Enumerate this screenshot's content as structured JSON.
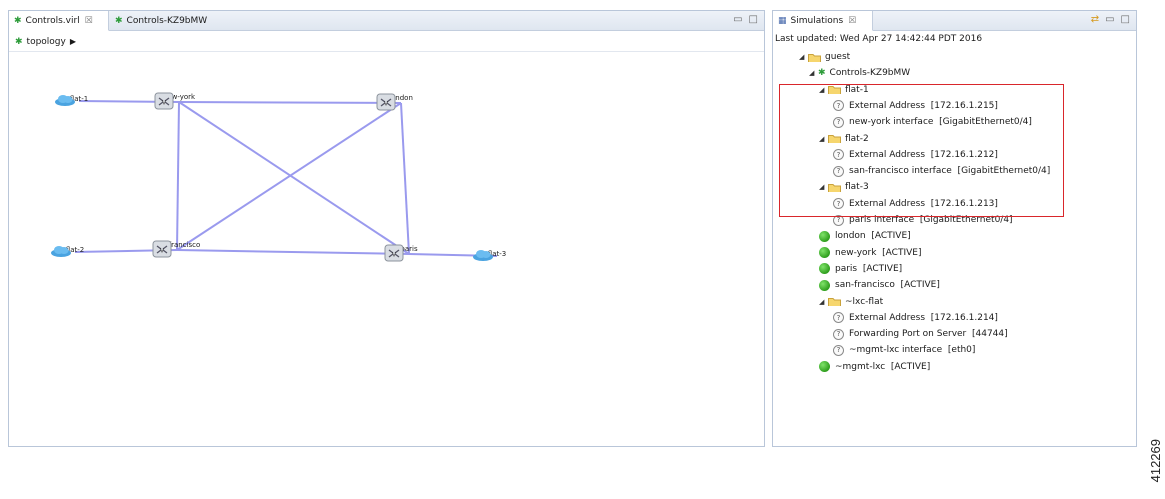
{
  "left_panel": {
    "tabs": [
      {
        "label": "Controls.virl",
        "close": "☒"
      },
      {
        "label": "Controls-KZ9bMW"
      }
    ],
    "breadcrumb": "topology",
    "nodes": [
      {
        "id": "flat-1",
        "label": "flat-1",
        "kind": "cloud"
      },
      {
        "id": "new-york",
        "label": "new-york",
        "kind": "router"
      },
      {
        "id": "london",
        "label": "london",
        "kind": "router"
      },
      {
        "id": "flat-2",
        "label": "flat-2",
        "kind": "cloud"
      },
      {
        "id": "san-francisco",
        "label": "san-francisco",
        "kind": "router"
      },
      {
        "id": "paris",
        "label": "paris",
        "kind": "router"
      },
      {
        "id": "flat-3",
        "label": "flat-3",
        "kind": "cloud"
      }
    ],
    "links": [
      [
        "flat-1",
        "new-york"
      ],
      [
        "new-york",
        "london"
      ],
      [
        "new-york",
        "san-francisco"
      ],
      [
        "new-york",
        "paris"
      ],
      [
        "london",
        "san-francisco"
      ],
      [
        "london",
        "paris"
      ],
      [
        "flat-2",
        "san-francisco"
      ],
      [
        "san-francisco",
        "paris"
      ],
      [
        "paris",
        "flat-3"
      ]
    ],
    "link_color": "#9a9aee"
  },
  "right_panel": {
    "tab_label": "Simulations",
    "tab_close": "☒",
    "last_updated": "Last updated: Wed Apr 27 14:42:44 PDT 2016",
    "tree": [
      {
        "level": 0,
        "type": "folder",
        "expanded": true,
        "label": "guest"
      },
      {
        "level": 1,
        "type": "topology",
        "expanded": true,
        "label": "Controls-KZ9bMW"
      },
      {
        "level": 2,
        "type": "folder",
        "expanded": true,
        "label": "flat-1"
      },
      {
        "level": 3,
        "type": "info",
        "label": "External Address  [172.16.1.215]"
      },
      {
        "level": 3,
        "type": "info",
        "label": "new-york interface  [GigabitEthernet0/4]"
      },
      {
        "level": 2,
        "type": "folder",
        "expanded": true,
        "label": "flat-2"
      },
      {
        "level": 3,
        "type": "info",
        "label": "External Address  [172.16.1.212]"
      },
      {
        "level": 3,
        "type": "info",
        "label": "san-francisco interface  [GigabitEthernet0/4]"
      },
      {
        "level": 2,
        "type": "folder",
        "expanded": true,
        "label": "flat-3"
      },
      {
        "level": 3,
        "type": "info",
        "label": "External Address  [172.16.1.213]"
      },
      {
        "level": 3,
        "type": "info",
        "label": "paris interface  [GigabitEthernet0/4]"
      },
      {
        "level": 2,
        "type": "active",
        "label": "london  [ACTIVE]"
      },
      {
        "level": 2,
        "type": "active",
        "label": "new-york  [ACTIVE]"
      },
      {
        "level": 2,
        "type": "active",
        "label": "paris  [ACTIVE]"
      },
      {
        "level": 2,
        "type": "active",
        "label": "san-francisco  [ACTIVE]"
      },
      {
        "level": 2,
        "type": "folder",
        "expanded": true,
        "label": "~lxc-flat"
      },
      {
        "level": 3,
        "type": "info",
        "label": "External Address  [172.16.1.214]"
      },
      {
        "level": 3,
        "type": "info",
        "label": "Forwarding Port on Server  [44744]"
      },
      {
        "level": 3,
        "type": "info",
        "label": "~mgmt-lxc interface  [eth0]"
      },
      {
        "level": 2,
        "type": "active",
        "label": "~mgmt-lxc  [ACTIVE]"
      }
    ],
    "highlight_color": "#d9262b"
  },
  "figure_id": "412269"
}
